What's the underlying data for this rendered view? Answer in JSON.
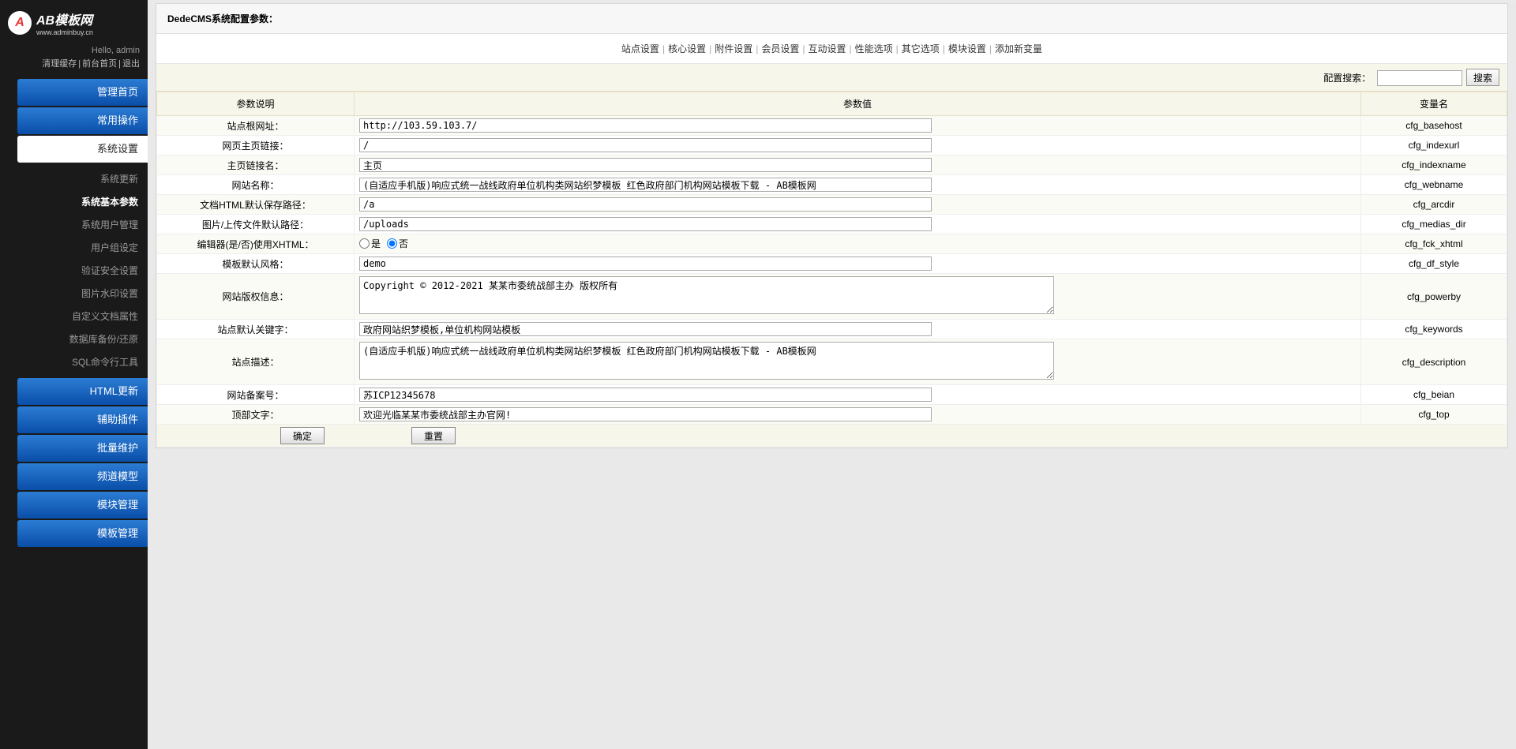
{
  "logo": {
    "icon_text": "A",
    "title": "AB模板网",
    "sub": "www.adminbuy.cn"
  },
  "hello": "Hello, admin",
  "top_links": {
    "cache": "清理缓存",
    "front": "前台首页",
    "logout": "退出"
  },
  "nav": [
    {
      "label": "管理首页",
      "active": false
    },
    {
      "label": "常用操作",
      "active": false
    },
    {
      "label": "系统设置",
      "active": true,
      "sub": [
        {
          "label": "系统更新",
          "active": false
        },
        {
          "label": "系统基本参数",
          "active": true
        },
        {
          "label": "系统用户管理",
          "active": false
        },
        {
          "label": "用户组设定",
          "active": false
        },
        {
          "label": "验证安全设置",
          "active": false
        },
        {
          "label": "图片水印设置",
          "active": false
        },
        {
          "label": "自定义文档属性",
          "active": false
        },
        {
          "label": "数据库备份/还原",
          "active": false
        },
        {
          "label": "SQL命令行工具",
          "active": false
        }
      ]
    },
    {
      "label": "HTML更新",
      "active": false
    },
    {
      "label": "辅助插件",
      "active": false
    },
    {
      "label": "批量维护",
      "active": false
    },
    {
      "label": "频道模型",
      "active": false
    },
    {
      "label": "模块管理",
      "active": false
    },
    {
      "label": "模板管理",
      "active": false
    }
  ],
  "panel_title": "DedeCMS系统配置参数：",
  "tabs": [
    "站点设置",
    "核心设置",
    "附件设置",
    "会员设置",
    "互动设置",
    "性能选项",
    "其它选项",
    "模块设置",
    "添加新变量"
  ],
  "search": {
    "label": "配置搜索：",
    "value": "",
    "btn": "搜索"
  },
  "headers": {
    "label": "参数说明",
    "value": "参数值",
    "var": "变量名"
  },
  "rows": [
    {
      "label": "站点根网址：",
      "type": "text",
      "value": "http://103.59.103.7/",
      "var": "cfg_basehost"
    },
    {
      "label": "网页主页链接：",
      "type": "text",
      "value": "/",
      "var": "cfg_indexurl"
    },
    {
      "label": "主页链接名：",
      "type": "text",
      "value": "主页",
      "var": "cfg_indexname"
    },
    {
      "label": "网站名称：",
      "type": "text",
      "value": "(自适应手机版)响应式统一战线政府单位机构类网站织梦模板 红色政府部门机构网站模板下载 - AB模板网",
      "var": "cfg_webname"
    },
    {
      "label": "文档HTML默认保存路径：",
      "type": "text",
      "value": "/a",
      "var": "cfg_arcdir"
    },
    {
      "label": "图片/上传文件默认路径：",
      "type": "text",
      "value": "/uploads",
      "var": "cfg_medias_dir"
    },
    {
      "label": "编辑器(是/否)使用XHTML：",
      "type": "radio",
      "options": [
        "是",
        "否"
      ],
      "selected": "否",
      "var": "cfg_fck_xhtml"
    },
    {
      "label": "模板默认风格：",
      "type": "text",
      "value": "demo",
      "var": "cfg_df_style"
    },
    {
      "label": "网站版权信息：",
      "type": "textarea",
      "rows": 3,
      "value": "Copyright © 2012-2021 某某市委统战部主办 版权所有",
      "var": "cfg_powerby"
    },
    {
      "label": "站点默认关键字：",
      "type": "text",
      "value": "政府网站织梦模板,单位机构网站模板",
      "var": "cfg_keywords"
    },
    {
      "label": "站点描述：",
      "type": "textarea",
      "rows": 3,
      "value": "(自适应手机版)响应式统一战线政府单位机构类网站织梦模板 红色政府部门机构网站模板下载 - AB模板网",
      "var": "cfg_description"
    },
    {
      "label": "网站备案号：",
      "type": "text",
      "value": "苏ICP12345678",
      "var": "cfg_beian"
    },
    {
      "label": "顶部文字：",
      "type": "text",
      "value": "欢迎光临某某市委统战部主办官网!",
      "var": "cfg_top"
    }
  ],
  "buttons": {
    "ok": "确定",
    "reset": "重置"
  }
}
